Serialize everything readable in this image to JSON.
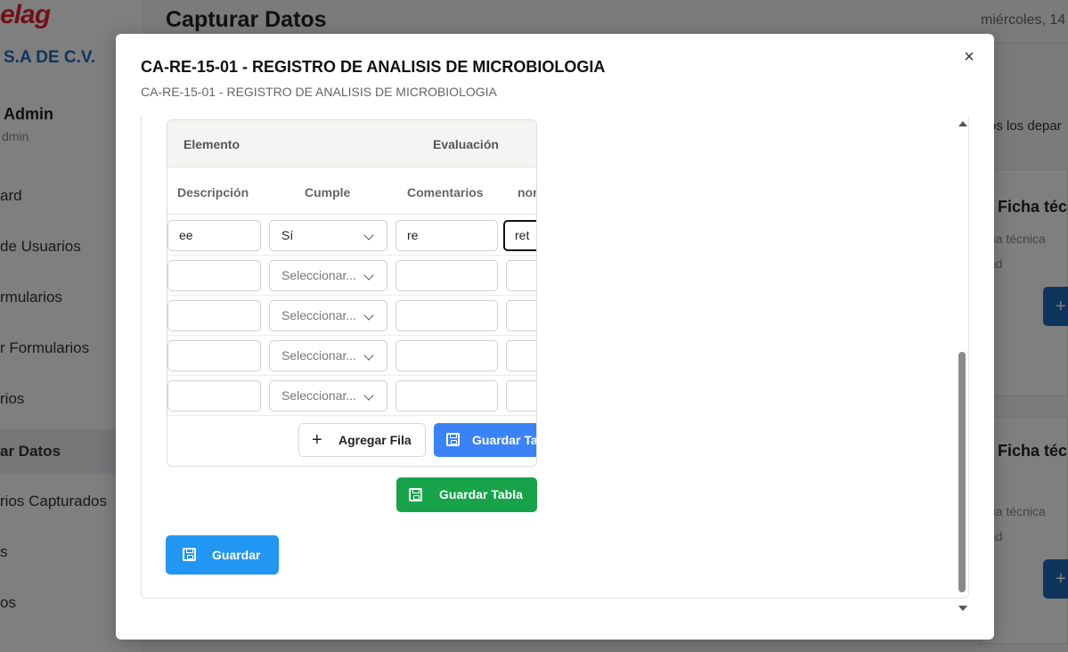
{
  "background": {
    "logo": "elag",
    "company": "S.A DE C.V.",
    "user_name": "Admin",
    "user_role": "dmin",
    "nav_items": [
      {
        "label": "ard"
      },
      {
        "label": "de Usuarios"
      },
      {
        "label": "rmularios"
      },
      {
        "label": "r Formularios"
      },
      {
        "label": "rios"
      },
      {
        "label": "ar Datos"
      },
      {
        "label": "rios Capturados"
      },
      {
        "label": "s"
      },
      {
        "label": "os"
      }
    ],
    "page_title": "Capturar Datos",
    "date": "miércoles, 14",
    "filter": "os los depar",
    "cards": [
      {
        "title": "Ficha técn",
        "sub1": "ha técnica",
        "sub2": "ad"
      },
      {
        "title": "Ficha técn",
        "sub1": "ha técnica",
        "sub2": "ad"
      }
    ]
  },
  "modal": {
    "title": "CA-RE-15-01 - REGISTRO DE ANALISIS DE MICROBIOLOGIA",
    "subtitle": "CA-RE-15-01 - REGISTRO DE ANALISIS DE MICROBIOLOGIA",
    "close_label": "×",
    "table": {
      "group_headers": {
        "elemento": "Elemento",
        "evaluacion": "Evaluación"
      },
      "columns": {
        "descripcion": "Descripción",
        "cumple": "Cumple",
        "comentarios": "Comentarios",
        "nombre": "nor"
      },
      "select_placeholder": "Seleccionar...",
      "rows": [
        {
          "descripcion": "ee",
          "cumple": "Sí",
          "comentarios": "re",
          "nombre": "ret"
        },
        {
          "descripcion": "",
          "cumple": "",
          "comentarios": "",
          "nombre": ""
        },
        {
          "descripcion": "",
          "cumple": "",
          "comentarios": "",
          "nombre": ""
        },
        {
          "descripcion": "",
          "cumple": "",
          "comentarios": "",
          "nombre": ""
        },
        {
          "descripcion": "",
          "cumple": "",
          "comentarios": "",
          "nombre": ""
        }
      ],
      "add_row_label": "Agregar Fila",
      "save_table_inner_label": "Guardar Ta"
    },
    "save_table_label": "Guardar Tabla",
    "save_label": "Guardar"
  }
}
